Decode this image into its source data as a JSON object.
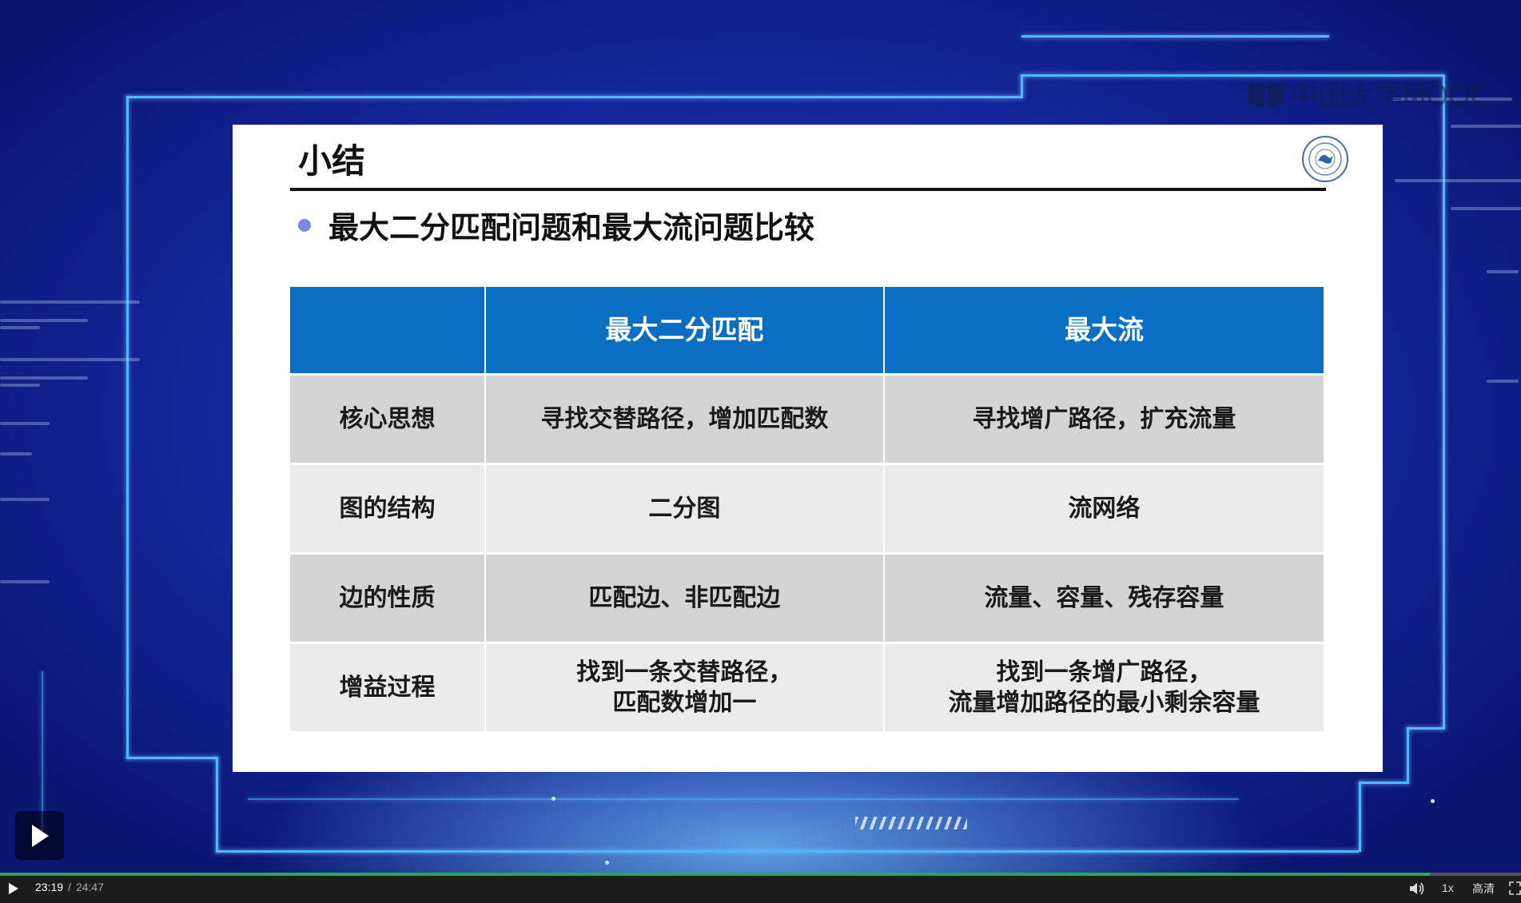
{
  "brand": {
    "text": "中国大学MOOC"
  },
  "slide": {
    "title": "小结",
    "bullet": "最大二分匹配问题和最大流问题比较",
    "table": {
      "headers": [
        "",
        "最大二分匹配",
        "最大流"
      ],
      "rows": [
        {
          "label": "核心思想",
          "matching": "寻找交替路径，增加匹配数",
          "flow": "寻找增广路径，扩充流量"
        },
        {
          "label": "图的结构",
          "matching": "二分图",
          "flow": "流网络"
        },
        {
          "label": "边的性质",
          "matching": "匹配边、非匹配边",
          "flow": "流量、容量、残存容量"
        },
        {
          "label": "增益过程",
          "matching": "找到一条交替路径，\n匹配数增加一",
          "flow": "找到一条增广路径，\n流量增加路径的最小剩余容量"
        }
      ]
    }
  },
  "player": {
    "current_time": "23:19",
    "separator": "/",
    "duration": "24:47",
    "progress": 0.94,
    "speed": "1x",
    "quality": "高清",
    "colors": {
      "progress": "#1fae4e",
      "table_header": "#0a6fc2"
    }
  },
  "icons": [
    "play-icon",
    "volume-icon",
    "fullscreen-icon",
    "university-logo"
  ]
}
